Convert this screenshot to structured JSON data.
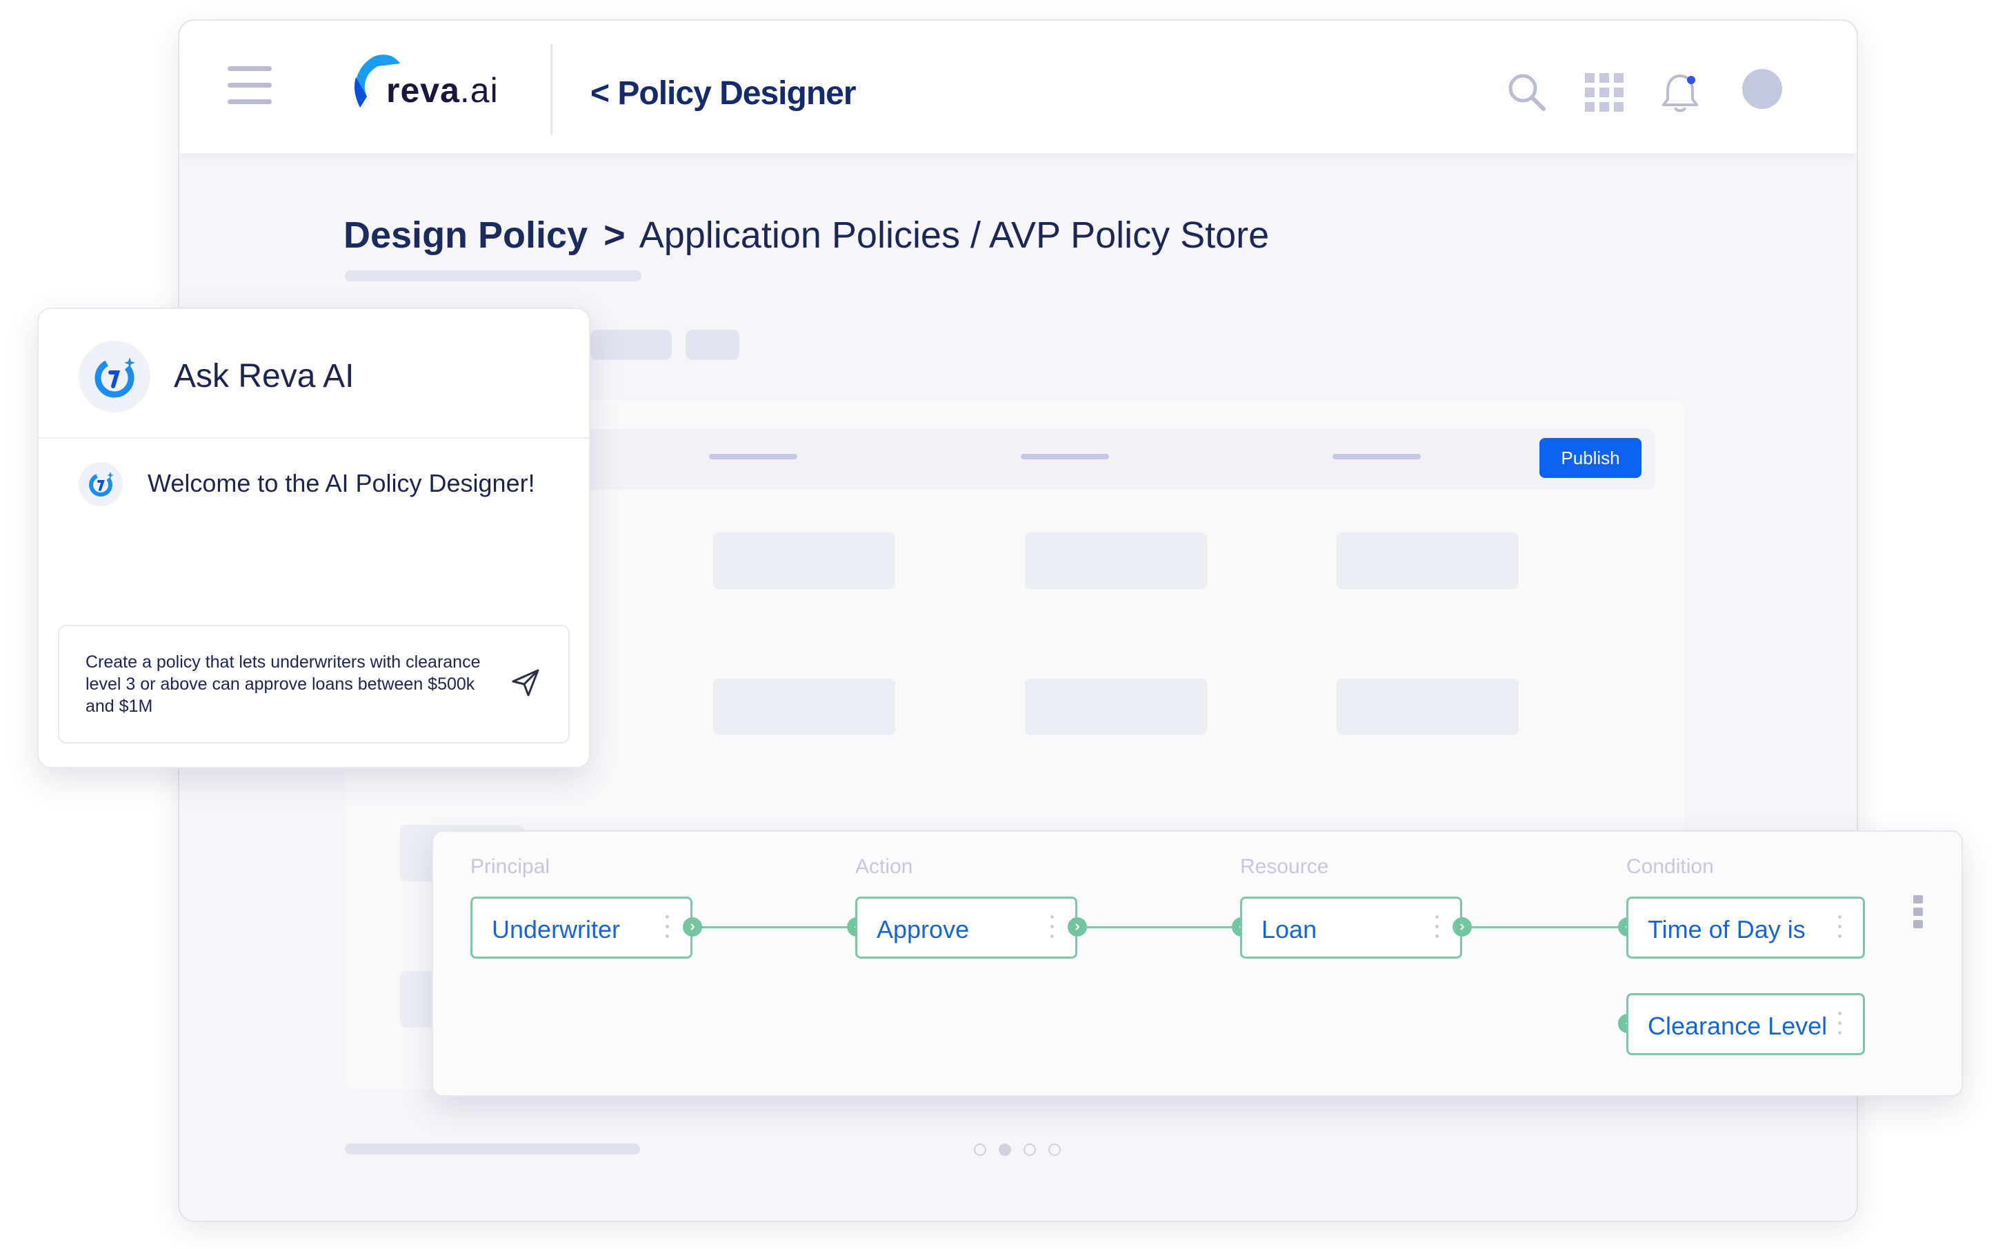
{
  "header": {
    "logo_text_bold": "reva",
    "logo_text_light": ".ai",
    "title": "< Policy Designer",
    "icons": [
      "hamburger-menu-icon",
      "search-icon",
      "apps-grid-icon",
      "notification-bell-icon",
      "user-avatar"
    ]
  },
  "breadcrumb": {
    "root": "Design Policy",
    "separator": ">",
    "path": "Application Policies / AVP Policy Store"
  },
  "toolbar": {
    "publish_label": "Publish"
  },
  "ask_ai": {
    "title": "Ask Reva AI",
    "welcome": "Welcome to the AI Policy Designer!",
    "input_value": "Create a policy that lets underwriters with clearance level 3 or above can approve loans between $500k and $1M"
  },
  "flow": {
    "columns": [
      "Principal",
      "Action",
      "Resource",
      "Condition"
    ],
    "nodes": [
      "Underwriter",
      "Approve",
      "Loan",
      "Time of Day is",
      "Clearance Level"
    ]
  },
  "pager": {
    "count": 4,
    "active_index": 1
  },
  "colors": {
    "brand_blue": "#0d62f0",
    "title_navy": "#152a6b",
    "node_border": "#7dc7a4",
    "node_text": "#1565d8",
    "window_bg": "#f5f5fa"
  }
}
